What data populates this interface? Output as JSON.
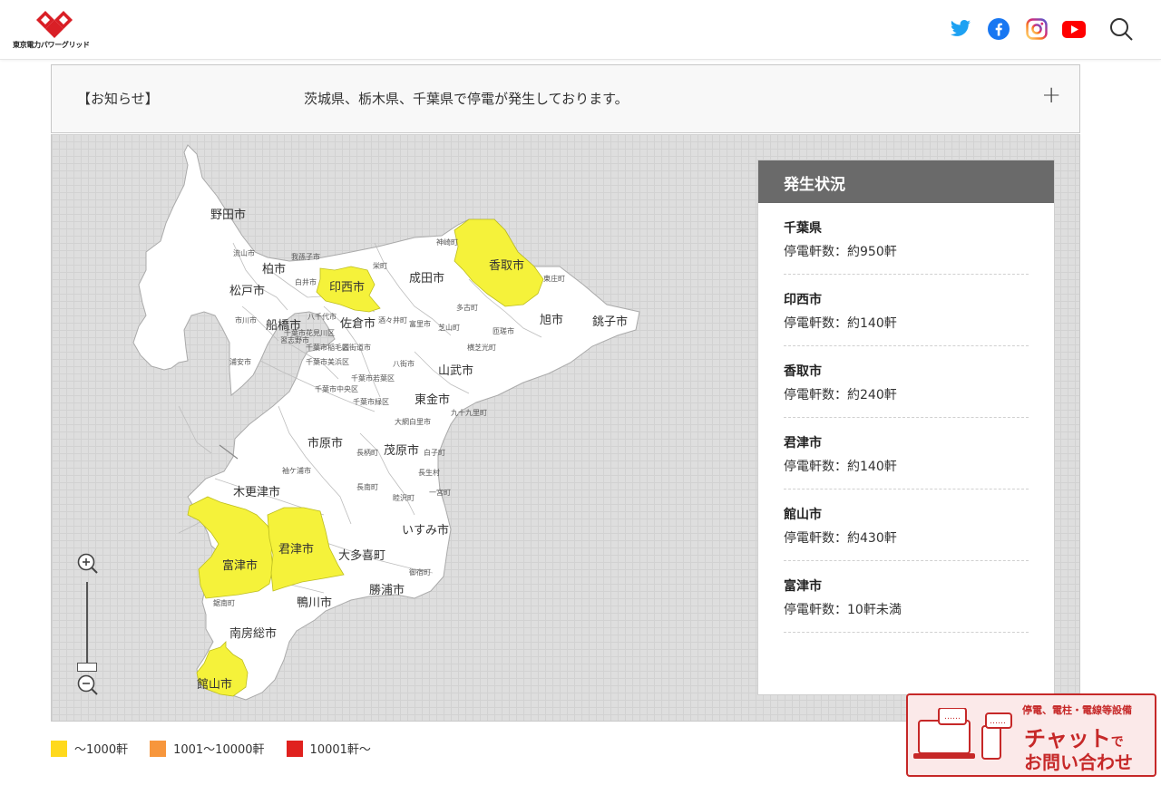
{
  "header": {
    "logo_text": "東京電力パワーグリッド"
  },
  "notice": {
    "label": "【お知らせ】",
    "text": "茨城県、栃木県、千葉県で停電が発生しております。",
    "expand": "+"
  },
  "map": {
    "cities": [
      "野田市",
      "柏市",
      "松戸市",
      "印西市",
      "成田市",
      "香取市",
      "船橋市",
      "佐倉市",
      "旭市",
      "銚子市",
      "山武市",
      "東金市",
      "市原市",
      "茂原市",
      "木更津市",
      "君津市",
      "富津市",
      "大多喜町",
      "いすみ市",
      "勝浦市",
      "鴨川市",
      "南房総市",
      "館山市"
    ],
    "small_towns": [
      "神崎町",
      "我孫子市",
      "白井市",
      "栄町",
      "流山市",
      "多古町",
      "東庄町",
      "匝瑳市",
      "八千代市",
      "市川市",
      "習志野市",
      "四街道市",
      "酒々井町",
      "富里市",
      "芝山町",
      "横芝光町",
      "浦安市",
      "千葉市若葉区",
      "八街市",
      "千葉市緑区",
      "大網白里市",
      "九十九里町",
      "長柄町",
      "白子町",
      "袖ケ浦市",
      "長生村",
      "長南町",
      "睦沢町",
      "一宮町",
      "御宿町",
      "鋸南町",
      "千葉市花見川区",
      "千葉市美浜区",
      "千葉市中央区",
      "千葉市稲毛区"
    ]
  },
  "status_panel": {
    "title": "発生状況",
    "items": [
      {
        "name": "千葉県",
        "count": "停電軒数：約950軒"
      },
      {
        "name": "印西市",
        "count": "停電軒数：約140軒"
      },
      {
        "name": "香取市",
        "count": "停電軒数：約240軒"
      },
      {
        "name": "君津市",
        "count": "停電軒数：約140軒"
      },
      {
        "name": "館山市",
        "count": "停電軒数：約430軒"
      },
      {
        "name": "富津市",
        "count": "停電軒数：10軒未満"
      }
    ]
  },
  "legend": [
    {
      "label": "～1000軒",
      "color": "#ffd91c"
    },
    {
      "label": "1001～10000軒",
      "color": "#f7963c"
    },
    {
      "label": "10001軒～",
      "color": "#e0211e"
    }
  ],
  "chat": {
    "sub": "停電、電柱・電線等設備",
    "main": "チャット",
    "main_suffix": "で",
    "line2": "お問い合わせ"
  },
  "colors": {
    "affected": "#f5f23a",
    "land": "#ffffff",
    "panel_header": "#6a6a6a",
    "chat_red": "#c62828"
  },
  "icons": [
    "twitter-icon",
    "facebook-icon",
    "instagram-icon",
    "youtube-icon",
    "search-icon",
    "zoom-in-icon",
    "zoom-out-icon",
    "plus-icon"
  ]
}
